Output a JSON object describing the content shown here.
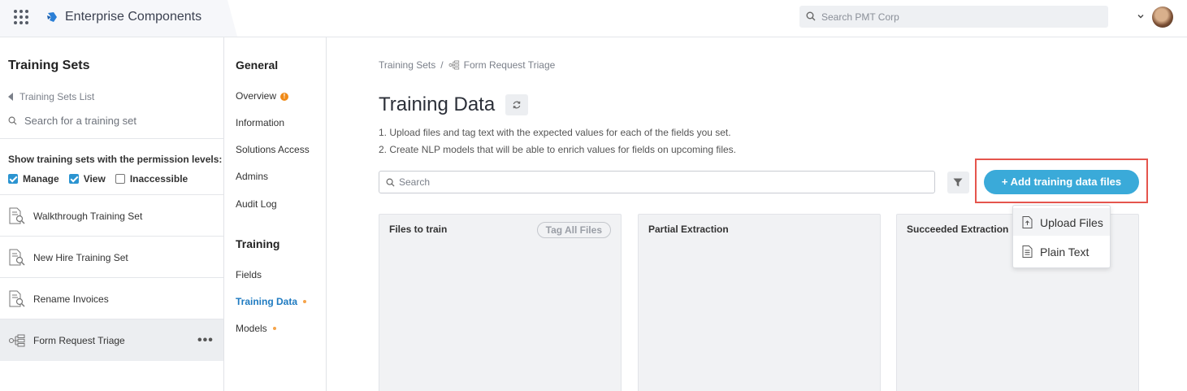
{
  "app": {
    "title": "Enterprise Components",
    "search_placeholder": "Search PMT Corp"
  },
  "left_panel": {
    "title": "Training Sets",
    "back_link": "Training Sets List",
    "search_placeholder": "Search for a training set",
    "permission_label": "Show training sets with the permission levels:",
    "permissions": [
      {
        "label": "Manage",
        "checked": true
      },
      {
        "label": "View",
        "checked": true
      },
      {
        "label": "Inaccessible",
        "checked": false
      }
    ],
    "training_sets": [
      {
        "name": "Walkthrough Training Set",
        "icon": "document-search-icon"
      },
      {
        "name": "New Hire Training Set",
        "icon": "document-search-icon"
      },
      {
        "name": "Rename Invoices",
        "icon": "document-search-icon"
      },
      {
        "name": "Form Request Triage",
        "icon": "flow-icon",
        "active": true,
        "more": "•••"
      }
    ]
  },
  "sec_nav": {
    "general_heading": "General",
    "general_items": [
      "Overview",
      "Information",
      "Solutions Access",
      "Admins",
      "Audit Log"
    ],
    "overview_badge": "!",
    "training_heading": "Training",
    "training_items": [
      "Fields",
      "Training Data",
      "Models"
    ],
    "active_item": "Training Data"
  },
  "main": {
    "breadcrumb": {
      "root": "Training Sets",
      "separator": "/",
      "current": "Form Request Triage"
    },
    "title": "Training Data",
    "instructions": [
      "1. Upload files and tag text with the expected values for each of the fields you set.",
      "2. Create NLP models that will be able to enrich values for fields on upcoming files."
    ],
    "search_placeholder": "Search",
    "add_button": "+ Add training data files",
    "columns": [
      {
        "title": "Files to train",
        "action": "Tag All Files"
      },
      {
        "title": "Partial Extraction"
      },
      {
        "title": "Succeeded Extraction"
      }
    ],
    "add_menu": [
      {
        "label": "Upload Files",
        "icon": "upload-file-icon"
      },
      {
        "label": "Plain Text",
        "icon": "text-document-icon"
      }
    ]
  },
  "colors": {
    "accent": "#3aaad9",
    "active_link": "#1f7bc1",
    "highlight": "#e5554d",
    "badge": "#f08a17",
    "checkbox": "#2b94d1"
  }
}
